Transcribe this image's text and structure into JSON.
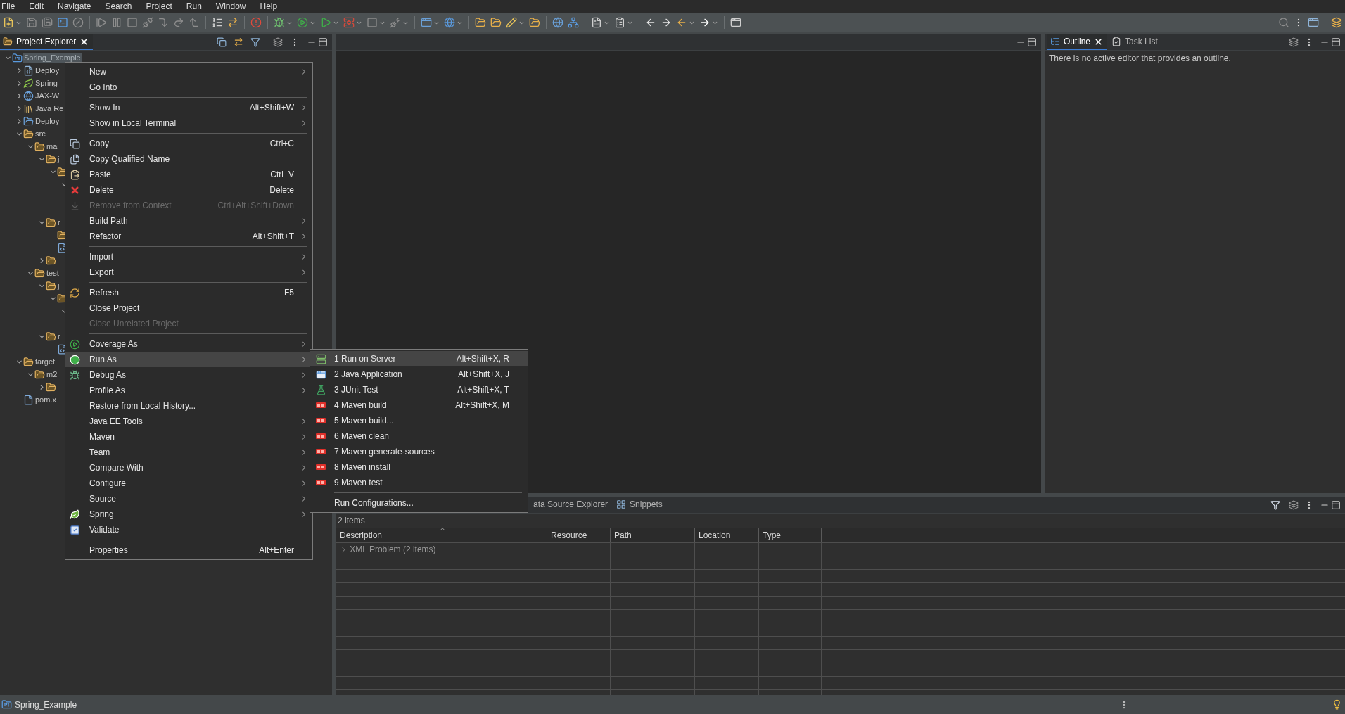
{
  "menu_bar": [
    "File",
    "Edit",
    "Navigate",
    "Search",
    "Project",
    "Run",
    "Window",
    "Help"
  ],
  "project_explorer": {
    "tabs": [
      {
        "label": "Project Explorer",
        "selected": true
      }
    ],
    "tree": [
      {
        "label": "Spring_Example",
        "kind": "project",
        "expanded": true,
        "selected": true,
        "children": [
          {
            "label": "Deploy",
            "kind": "descriptor",
            "expanded": false,
            "selected": false
          },
          {
            "label": "Spring",
            "kind": "spring",
            "expanded": false,
            "selected": false
          },
          {
            "label": "JAX-W",
            "kind": "webservice",
            "expanded": false,
            "selected": false
          },
          {
            "label": "Java Re",
            "kind": "library",
            "expanded": false,
            "selected": false
          },
          {
            "label": "Deploy",
            "kind": "deploy",
            "expanded": false,
            "selected": false
          },
          {
            "label": "src",
            "kind": "folder",
            "expanded": true,
            "selected": false,
            "children": [
              {
                "label": "mai",
                "kind": "folder",
                "expanded": true,
                "selected": false,
                "children": [
                  {
                    "label": "j",
                    "kind": "folder",
                    "expanded": true,
                    "selected": false,
                    "children": [
                      {
                        "kind": "folder",
                        "expanded": true,
                        "selected": false,
                        "children": [
                          {
                            "expanded": true,
                            "selected": false,
                            "children": [
                              {
                                "selected": false
                              },
                              {
                                "selected": false
                              }
                            ]
                          }
                        ]
                      }
                    ]
                  },
                  {
                    "label": "r",
                    "kind": "folder",
                    "expanded": true,
                    "selected": false,
                    "children": [
                      {
                        "kind": "folder",
                        "selected": false
                      },
                      {
                        "kind": "xml",
                        "selected": false
                      }
                    ]
                  },
                  {
                    "kind": "folder",
                    "expanded": false,
                    "selected": false
                  }
                ]
              },
              {
                "label": "test",
                "kind": "folder",
                "expanded": true,
                "selected": false,
                "children": [
                  {
                    "label": "j",
                    "kind": "folder",
                    "expanded": true,
                    "selected": false,
                    "children": [
                      {
                        "kind": "folder",
                        "expanded": true,
                        "selected": false,
                        "children": [
                          {
                            "expanded": true,
                            "selected": false,
                            "children": [
                              {
                                "selected": false
                              }
                            ]
                          }
                        ]
                      }
                    ]
                  },
                  {
                    "label": "r",
                    "kind": "folder",
                    "expanded": true,
                    "selected": false,
                    "children": [
                      {
                        "kind": "xml",
                        "selected": false
                      }
                    ]
                  }
                ]
              }
            ]
          },
          {
            "label": "target",
            "kind": "folder",
            "expanded": true,
            "selected": false,
            "children": [
              {
                "label": "m2",
                "kind": "folder",
                "expanded": true,
                "selected": false,
                "children": [
                  {
                    "kind": "folder",
                    "expanded": false,
                    "selected": false
                  }
                ]
              }
            ]
          },
          {
            "label": "pom.x",
            "kind": "pom",
            "selected": false
          }
        ]
      }
    ]
  },
  "outline": {
    "tabs": [
      {
        "label": "Outline",
        "kind": "outline",
        "closable": true,
        "selected": true
      },
      {
        "label": "Task List",
        "kind": "tasks",
        "closable": false,
        "selected": false
      }
    ],
    "message": "There is no active editor that provides an outline."
  },
  "bottom_panel": {
    "tabs": [
      {
        "label": "ata Source Explorer",
        "selected": false
      },
      {
        "label": "Snippets",
        "kind": "snippets",
        "selected": false
      }
    ],
    "count": "2 items",
    "columns": [
      "Description",
      "Resource",
      "Path",
      "Location",
      "Type"
    ],
    "rows": [
      {
        "description": "XML Problem (2 items)",
        "expanded": false
      }
    ]
  },
  "context_menu": {
    "sections": [
      {
        "items": [
          {
            "label": "New",
            "submenu": true,
            "disabled": false,
            "selected": false
          },
          {
            "label": "Go Into",
            "submenu": false,
            "disabled": false,
            "selected": false
          }
        ]
      },
      {
        "items": [
          {
            "label": "Show In",
            "shortcut": "Alt+Shift+W",
            "submenu": true,
            "disabled": false,
            "selected": false
          },
          {
            "label": "Show in Local Terminal",
            "submenu": true,
            "disabled": false,
            "selected": false
          }
        ]
      },
      {
        "items": [
          {
            "label": "Copy",
            "shortcut": "Ctrl+C",
            "kind": "copy",
            "submenu": false,
            "disabled": false,
            "selected": false
          },
          {
            "label": "Copy Qualified Name",
            "kind": "copy_name",
            "submenu": false,
            "disabled": false,
            "selected": false
          },
          {
            "label": "Paste",
            "shortcut": "Ctrl+V",
            "kind": "paste",
            "submenu": false,
            "disabled": false,
            "selected": false
          },
          {
            "label": "Delete",
            "shortcut": "Delete",
            "kind": "delete",
            "submenu": false,
            "disabled": false,
            "selected": false
          },
          {
            "label": "Remove from Context",
            "shortcut": "Ctrl+Alt+Shift+Down",
            "kind": "remove",
            "submenu": false,
            "disabled": true,
            "selected": false
          },
          {
            "label": "Build Path",
            "submenu": true,
            "disabled": false,
            "selected": false
          },
          {
            "label": "Refactor",
            "shortcut": "Alt+Shift+T",
            "submenu": true,
            "disabled": false,
            "selected": false
          }
        ]
      },
      {
        "items": [
          {
            "label": "Import",
            "submenu": true,
            "disabled": false,
            "selected": false
          },
          {
            "label": "Export",
            "submenu": true,
            "disabled": false,
            "selected": false
          }
        ]
      },
      {
        "items": [
          {
            "label": "Refresh",
            "shortcut": "F5",
            "kind": "refresh",
            "submenu": false,
            "disabled": false,
            "selected": false
          },
          {
            "label": "Close Project",
            "submenu": false,
            "disabled": false,
            "selected": false
          },
          {
            "label": "Close Unrelated Project",
            "submenu": false,
            "disabled": true,
            "selected": false
          }
        ]
      },
      {
        "items": [
          {
            "label": "Coverage As",
            "kind": "coverage",
            "submenu": true,
            "disabled": false,
            "selected": false
          },
          {
            "label": "Run As",
            "kind": "run",
            "submenu": true,
            "disabled": false,
            "selected": true
          },
          {
            "label": "Debug As",
            "kind": "debug",
            "submenu": true,
            "disabled": false,
            "selected": false
          },
          {
            "label": "Profile As",
            "submenu": true,
            "disabled": false,
            "selected": false
          },
          {
            "label": "Restore from Local History...",
            "submenu": false,
            "disabled": false,
            "selected": false
          },
          {
            "label": "Java EE Tools",
            "submenu": true,
            "disabled": false,
            "selected": false
          },
          {
            "label": "Maven",
            "submenu": true,
            "disabled": false,
            "selected": false
          },
          {
            "label": "Team",
            "submenu": true,
            "disabled": false,
            "selected": false
          },
          {
            "label": "Compare With",
            "submenu": true,
            "disabled": false,
            "selected": false
          },
          {
            "label": "Configure",
            "submenu": true,
            "disabled": false,
            "selected": false
          },
          {
            "label": "Source",
            "submenu": true,
            "disabled": false,
            "selected": false
          },
          {
            "label": "Spring",
            "kind": "spring",
            "submenu": true,
            "disabled": false,
            "selected": false
          },
          {
            "label": "Validate",
            "kind": "validate",
            "submenu": false,
            "disabled": false,
            "selected": false
          }
        ]
      },
      {
        "items": [
          {
            "label": "Properties",
            "shortcut": "Alt+Enter",
            "submenu": false,
            "disabled": false,
            "selected": false
          }
        ]
      }
    ]
  },
  "run_as_submenu": {
    "sections": [
      {
        "items": [
          {
            "label": "1 Run on Server",
            "shortcut": "Alt+Shift+X, R",
            "kind": "server",
            "submenu": false,
            "disabled": false,
            "selected": true
          },
          {
            "label": "2 Java Application",
            "shortcut": "Alt+Shift+X, J",
            "kind": "java_app",
            "submenu": false,
            "disabled": false,
            "selected": false
          },
          {
            "label": "3 JUnit Test",
            "shortcut": "Alt+Shift+X, T",
            "kind": "junit",
            "submenu": false,
            "disabled": false,
            "selected": false
          },
          {
            "label": "4 Maven build",
            "shortcut": "Alt+Shift+X, M",
            "kind": "maven",
            "submenu": false,
            "disabled": false,
            "selected": false
          },
          {
            "label": "5 Maven build...",
            "kind": "maven",
            "submenu": false,
            "disabled": false,
            "selected": false
          },
          {
            "label": "6 Maven clean",
            "kind": "maven",
            "submenu": false,
            "disabled": false,
            "selected": false
          },
          {
            "label": "7 Maven generate-sources",
            "kind": "maven",
            "submenu": false,
            "disabled": false,
            "selected": false
          },
          {
            "label": "8 Maven install",
            "kind": "maven",
            "submenu": false,
            "disabled": false,
            "selected": false
          },
          {
            "label": "9 Maven test",
            "kind": "maven",
            "submenu": false,
            "disabled": false,
            "selected": false
          }
        ]
      },
      {
        "items": [
          {
            "label": "Run Configurations...",
            "submenu": false,
            "disabled": false,
            "selected": false
          }
        ]
      }
    ]
  },
  "status_bar": {
    "text": "Spring_Example"
  }
}
